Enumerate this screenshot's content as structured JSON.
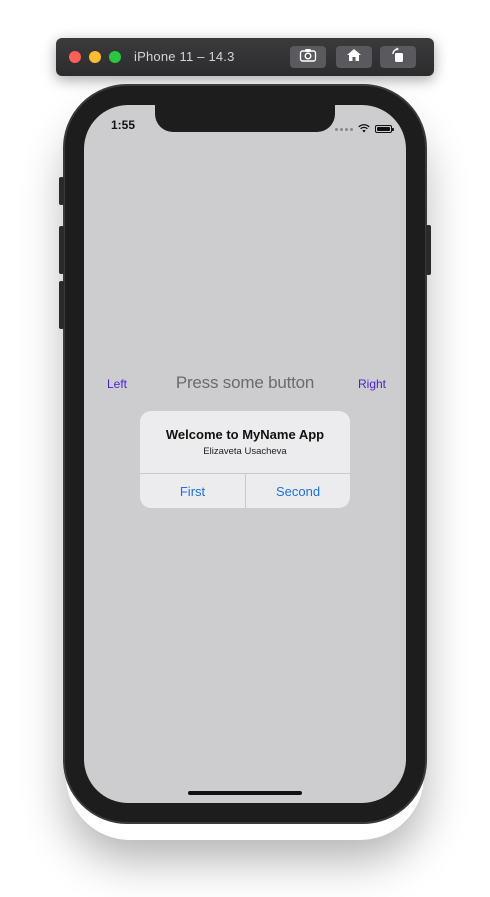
{
  "simulator": {
    "title": "iPhone 11 – 14.3",
    "buttons": [
      "screenshot-icon",
      "home-icon",
      "rotate-icon"
    ]
  },
  "status_bar": {
    "time": "1:55"
  },
  "main": {
    "left_button": "Left",
    "right_button": "Right",
    "label": "Press some button"
  },
  "alert": {
    "title": "Welcome to MyName App",
    "message": "Elizaveta Usacheva",
    "first_button": "First",
    "second_button": "Second"
  },
  "colors": {
    "screen_background": "#cdcdcf",
    "side_button_text": "#4b1fd6",
    "alert_button_text": "#1a73e0"
  }
}
